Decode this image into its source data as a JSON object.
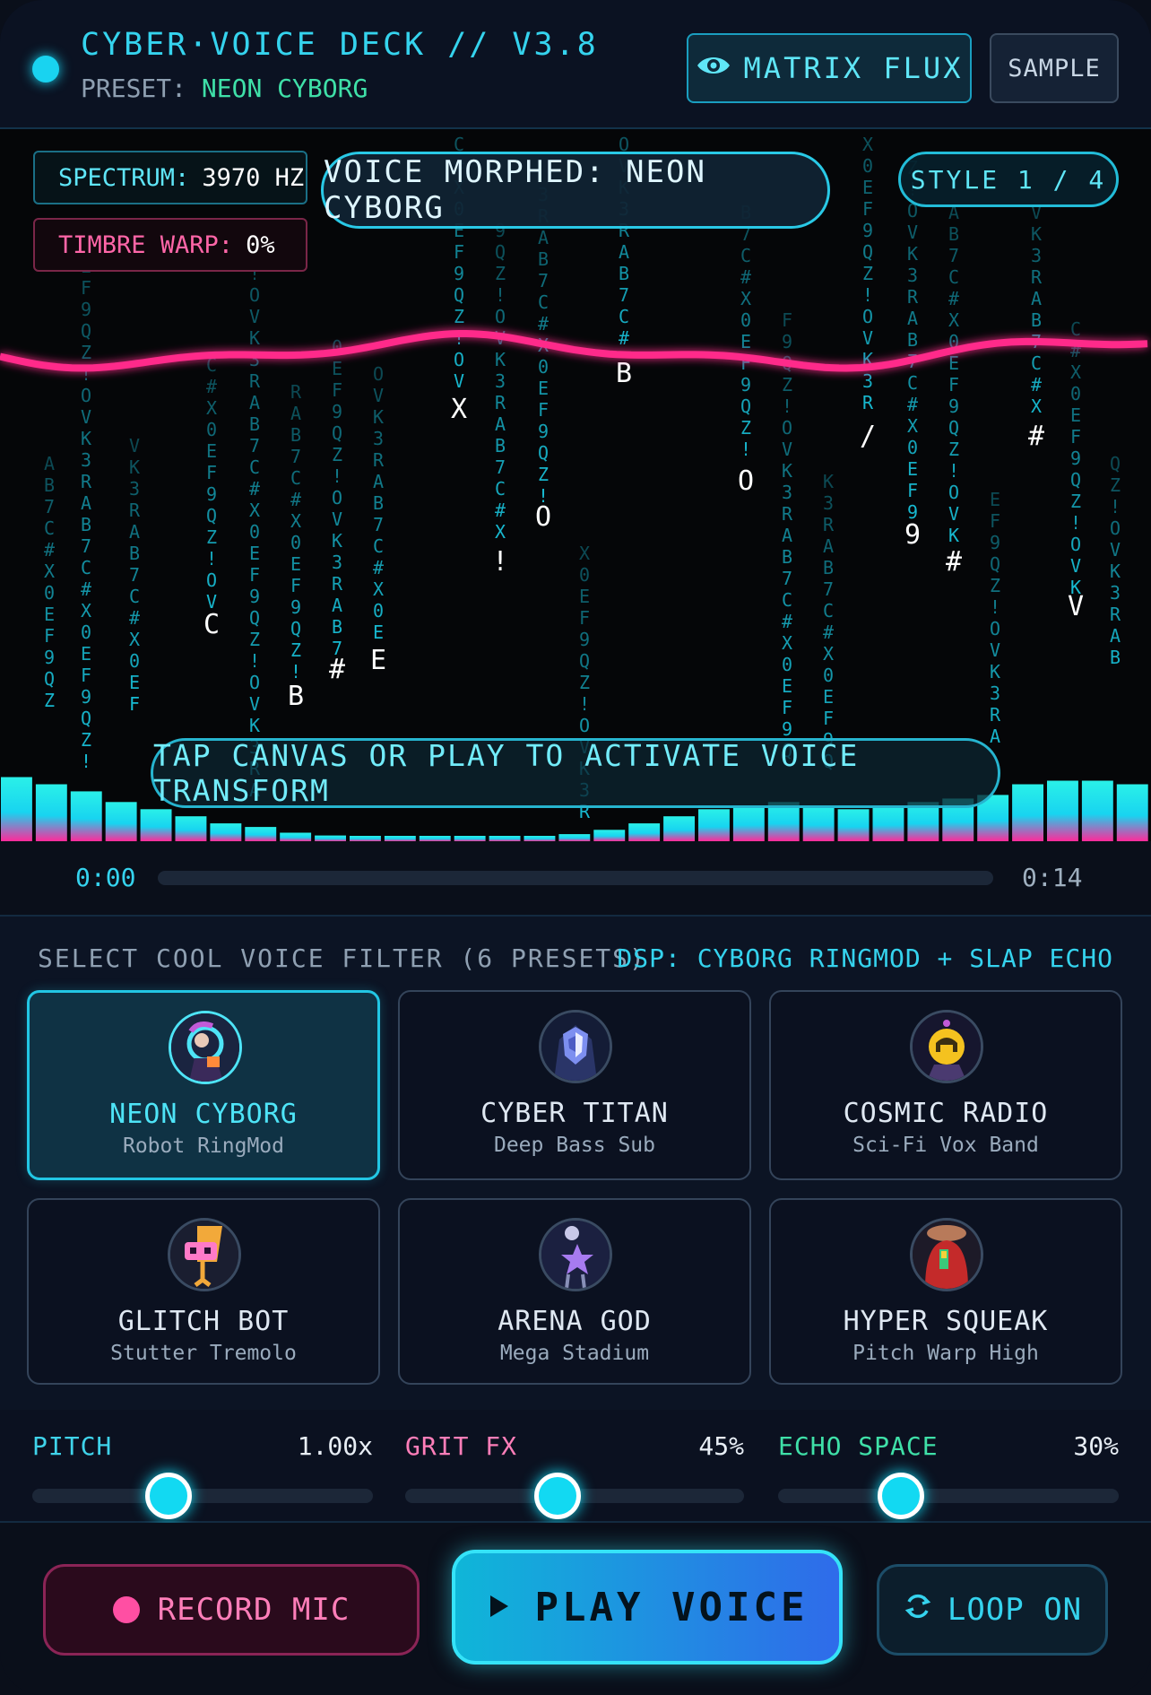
{
  "header": {
    "title": "CYBER·VOICE DECK // V3.8",
    "preset_prefix": "PRESET:",
    "preset_name": "NEON CYBORG",
    "matrix_button": "MATRIX FLUX",
    "sample_button": "SAMPLE"
  },
  "visualizer": {
    "spectrum_label": "SPECTRUM:",
    "spectrum_value": "3970 HZ",
    "timbre_label": "TIMBRE WARP:",
    "timbre_value": "0%",
    "morph_banner": "VOICE MORPHED: NEON CYBORG",
    "style_indicator": "STYLE 1 / 4",
    "hint": "TAP CANVAS OR PLAY TO ACTIVATE VOICE TRANSFORM",
    "rain_heads": [
      "C",
      "B",
      "#",
      "E",
      "X",
      "!",
      "O",
      "B",
      "O",
      "/",
      "9",
      "#",
      "#",
      "V"
    ],
    "wave_color": "#ff2a8a",
    "rain_color": "#19c6df"
  },
  "timeline": {
    "current": "0:00",
    "duration": "0:14",
    "progress": 0
  },
  "filters": {
    "title": "SELECT COOL VOICE FILTER (6 PRESETS)",
    "dsp": "DSP: CYBORG RINGMOD + SLAP ECHO",
    "items": [
      {
        "name": "NEON CYBORG",
        "sub": "Robot RingMod",
        "active": true,
        "icon": "cyborg-avatar-icon"
      },
      {
        "name": "CYBER TITAN",
        "sub": "Deep Bass Sub",
        "active": false,
        "icon": "titan-shield-icon"
      },
      {
        "name": "COSMIC RADIO",
        "sub": "Sci-Fi Vox Band",
        "active": false,
        "icon": "cosmic-radio-icon"
      },
      {
        "name": "GLITCH BOT",
        "sub": "Stutter Tremolo",
        "active": false,
        "icon": "glitch-bot-icon"
      },
      {
        "name": "ARENA GOD",
        "sub": "Mega Stadium",
        "active": false,
        "icon": "arena-star-icon"
      },
      {
        "name": "HYPER SQUEAK",
        "sub": "Pitch Warp High",
        "active": false,
        "icon": "squeak-creature-icon"
      }
    ]
  },
  "sliders": {
    "pitch": {
      "label": "PITCH",
      "value": "1.00x",
      "level": 0.4,
      "color": "#3fd3ea"
    },
    "grit": {
      "label": "GRIT FX",
      "value": "45%",
      "level": 0.45,
      "color": "#ff7eb9"
    },
    "echo": {
      "label": "ECHO SPACE",
      "value": "30%",
      "level": 0.36,
      "color": "#3fe0a8"
    }
  },
  "controls": {
    "record": "RECORD MIC",
    "play": "PLAY VOICE",
    "loop": "LOOP ON"
  }
}
